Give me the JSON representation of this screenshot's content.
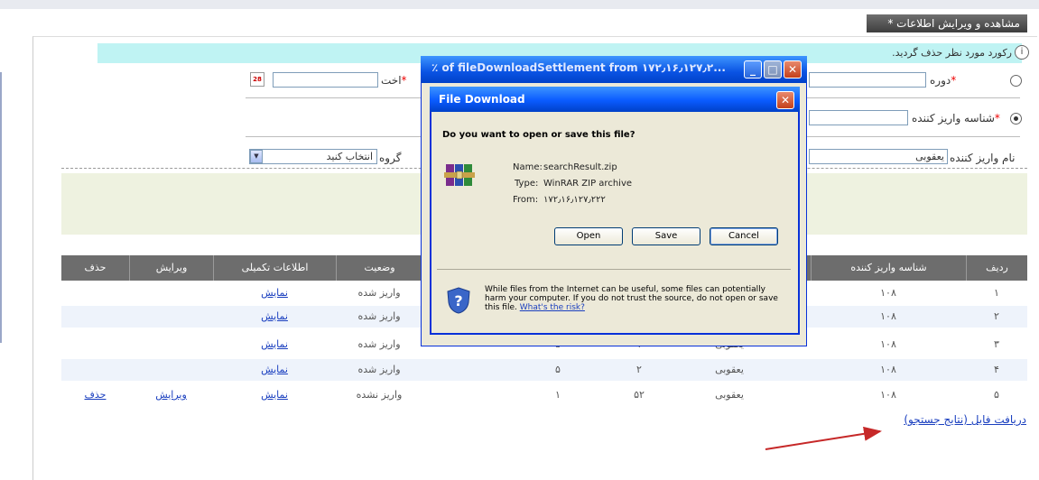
{
  "header": {
    "tab_label": "مشاهده و ویرایش اطلاعات *"
  },
  "message": {
    "text": "رکورد مورد نظر حذف گردید."
  },
  "form": {
    "period_label": "دوره",
    "payer_id_label": "شناسه واریز کننده",
    "date_label": "اخت",
    "payer_name_label": "نام واریز کننده",
    "payer_name_value": "یعقوبی",
    "group_label": "گروه",
    "group_selected": "انتخاب کنید",
    "calendar_icon": "calendar-icon",
    "required_mark": "*"
  },
  "table": {
    "headers": [
      "ردیف",
      "شناسه واریز کننده",
      "",
      "",
      "",
      "وضعیت",
      "اطلاعات تکمیلی",
      "ویرایش",
      "حذف"
    ],
    "rows": [
      {
        "idx": "۱",
        "payer_id": "۱۰۸",
        "name": "",
        "c1": "",
        "c2": "",
        "status": "واریز شده",
        "info": "نمایش",
        "edit": "",
        "delete": ""
      },
      {
        "idx": "۲",
        "payer_id": "۱۰۸",
        "name": "",
        "c1": "",
        "c2": "",
        "status": "واریز شده",
        "info": "نمایش",
        "edit": "",
        "delete": ""
      },
      {
        "idx": "۳",
        "payer_id": "۱۰۸",
        "name": "یعقوبی",
        "c1": "۱",
        "c2": "۵",
        "status": "واریز شده",
        "info": "نمایش",
        "edit": "",
        "delete": ""
      },
      {
        "idx": "۴",
        "payer_id": "۱۰۸",
        "name": "یعقوبی",
        "c1": "۲",
        "c2": "۵",
        "status": "واریز شده",
        "info": "نمایش",
        "edit": "",
        "delete": ""
      },
      {
        "idx": "۵",
        "payer_id": "۱۰۸",
        "name": "یعقوبی",
        "c1": "۵۲",
        "c2": "۱",
        "status": "واریز نشده",
        "info": "نمایش",
        "edit": "ویرایش",
        "delete": "حذف"
      }
    ]
  },
  "download_link": "دریافت فایل (نتایج جستجو)",
  "background_window": {
    "title": "٪ of fileDownloadSettlement from ۱۷۲٫۱۶٫۱۲۷٫۲..."
  },
  "dialog": {
    "title": "File Download",
    "question": "Do you want to open or save this file?",
    "name_label": "Name:",
    "name_value": "searchResult.zip",
    "type_label": "Type:",
    "type_value": "WinRAR ZIP archive",
    "from_label": "From:",
    "from_value": "۱۷۲٫۱۶٫۱۲۷٫۲۲۲",
    "open_label": "Open",
    "save_label": "Save",
    "cancel_label": "Cancel",
    "warning": "While files from the Internet can be useful, some files can potentially harm your computer. If you do not trust the source, do not open or save this file.",
    "risk_link": "What's the risk?"
  },
  "colors": {
    "accent_blue": "#0a53e3",
    "table_header": "#6d6d6d",
    "message_bg": "#bff3f3",
    "link": "#1a3fbf",
    "arrow": "#c62828"
  }
}
